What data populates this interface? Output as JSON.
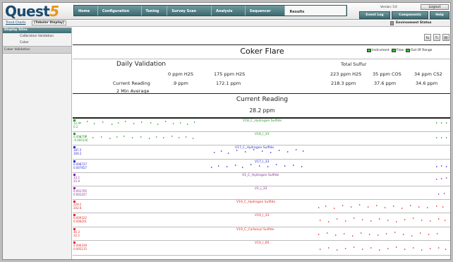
{
  "header": {
    "logo_main": "Quest",
    "logo_num": "5",
    "nav_tabs": [
      {
        "label": "Home",
        "width": 34
      },
      {
        "label": "Configuration",
        "width": 62
      },
      {
        "label": "Tuning",
        "width": 37
      },
      {
        "label": "Survey Scan",
        "width": 63
      },
      {
        "label": "Analysis",
        "width": 48
      },
      {
        "label": "Sequencer",
        "width": 57
      },
      {
        "label": "Results",
        "width": 87,
        "active": true
      }
    ],
    "user_name": "Version: 5.6",
    "logout_label": "Logout",
    "event_log_label": "Event Log",
    "components_label": "Components",
    "help_label": "Help"
  },
  "subbar": {
    "trend_charts_label": "Trend Charts",
    "tabular_label": "[Tabular Display]",
    "env_status_label": "Environment Status"
  },
  "sidebar": {
    "header": "Display Sites",
    "items": [
      {
        "label": "Calibration Validation"
      },
      {
        "label": "Coker"
      },
      {
        "label": "Coker Validation"
      }
    ]
  },
  "main": {
    "title": "Coker Flare",
    "legend": [
      {
        "label": "Instrument",
        "color": "#2fc02f"
      },
      {
        "label": "Flow",
        "color": "#2fc02f"
      },
      {
        "label": "Out Of Range",
        "color": "#2fc02f"
      }
    ],
    "daily_validation_label": "Daily Validation",
    "total_sulfur_label": "Total Sulfur",
    "col_headers": [
      "0 ppm H2S",
      "175 ppm H2S",
      "223 ppm H2S",
      "35 ppm COS",
      "34 ppm CS2"
    ],
    "current_reading_label": "Current Reading",
    "current_values": [
      ".9 ppm",
      "172.1 ppm",
      "218.3 ppm",
      "37.6 ppm",
      "34.6 ppm"
    ],
    "avg_label": "2 Min Average",
    "current_reading_title": "Current Reading",
    "current_reading_value": "28.2 ppm"
  },
  "strips": [
    {
      "label": "V18_C_Hydrogen Sulfide",
      "color": "#2a9a2a",
      "ylabels": [
        "12.4",
        "0.2"
      ]
    },
    {
      "label": "V18_I_33",
      "color": "#2a9a2a",
      "ylabels": [
        "0.000702",
        "-0.000126"
      ]
    },
    {
      "label": "V17_C_Hydrogen Sulfide",
      "color": "#2b2bcc",
      "ylabels": [
        "187.5",
        "169.2"
      ]
    },
    {
      "label": "V17_I_33",
      "color": "#2b2bcc",
      "ylabels": [
        "0.008727",
        "0.007657"
      ]
    },
    {
      "label": "V1_C_Hydrogen Sulfide",
      "color": "#8a2a9a",
      "ylabels": [
        "33.2",
        "25.9"
      ]
    },
    {
      "label": "V1_I_33",
      "color": "#8a2a9a",
      "ylabels": [
        "0.001705",
        "0.001257"
      ]
    },
    {
      "label": "V19_C_Hydrogen Sulfide",
      "color": "#dd2a2a",
      "ylabels": [
        "229.2",
        "202.8"
      ]
    },
    {
      "label": "V19_I_33",
      "color": "#dd2a2a",
      "ylabels": [
        "0.009322",
        "0.008201"
      ]
    },
    {
      "label": "V19_C_Carbonyl Sulfide",
      "color": "#dd2a2a",
      "ylabels": [
        "40.3",
        "32.5"
      ]
    },
    {
      "label": "V19_I_60",
      "color": "#dd2a2a",
      "ylabels": [
        "0.006339",
        "0.005115"
      ]
    }
  ]
}
